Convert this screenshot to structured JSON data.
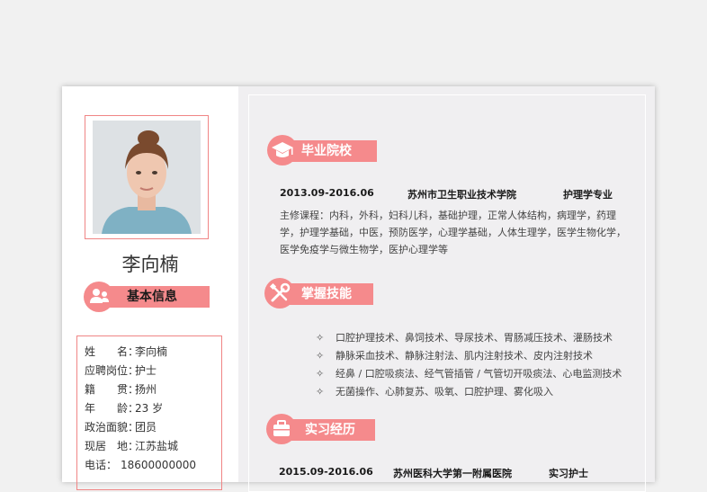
{
  "profile": {
    "name": "李向楠",
    "basic_info_title": "基本信息",
    "fields": [
      {
        "label": "姓　　名：",
        "value": "李向楠"
      },
      {
        "label": "应聘岗位：",
        "value": "护士"
      },
      {
        "label": "籍　　贯：",
        "value": "扬州"
      },
      {
        "label": "年　　龄：",
        "value": "23 岁"
      },
      {
        "label": "政治面貌：",
        "value": "团员"
      },
      {
        "label": "现居　地：",
        "value": "江苏盐城"
      },
      {
        "label": "电话：",
        "value": "18600000000"
      }
    ]
  },
  "education": {
    "title": "毕业院校",
    "period": "2013.09-2016.06",
    "school": "苏州市卫生职业技术学院",
    "major": "护理学专业",
    "courses": [
      "主修课程：内科，外科，妇科儿科，基础护理，正常人体结构，病理学，药理",
      "学，护理学基础，中医，预防医学，心理学基础，人体生理学，医学生物化学，",
      "医学免疫学与微生物学，医护心理学等"
    ]
  },
  "skills": {
    "title": "掌握技能",
    "items": [
      "口腔护理技术、鼻饲技术、导尿技术、胃肠减压技术、灌肠技术",
      "静脉采血技术、静脉注射法、肌内注射技术、皮内注射技术",
      "经鼻 / 口腔吸痰法、经气管插管 / 气管切开吸痰法、心电监测技术",
      "无菌操作、心肺复苏、吸氧、口腔护理、雾化吸入"
    ]
  },
  "internship": {
    "title": "实习经历",
    "period": "2015.09-2016.06",
    "org": "苏州医科大学第一附属医院",
    "role": "实习护士"
  },
  "colors": {
    "accent": "#f58a8c",
    "border": "#f08585"
  },
  "icons": {
    "basic": "person-icon",
    "education": "graduation-cap-icon",
    "skills": "tools-icon",
    "internship": "briefcase-icon"
  }
}
